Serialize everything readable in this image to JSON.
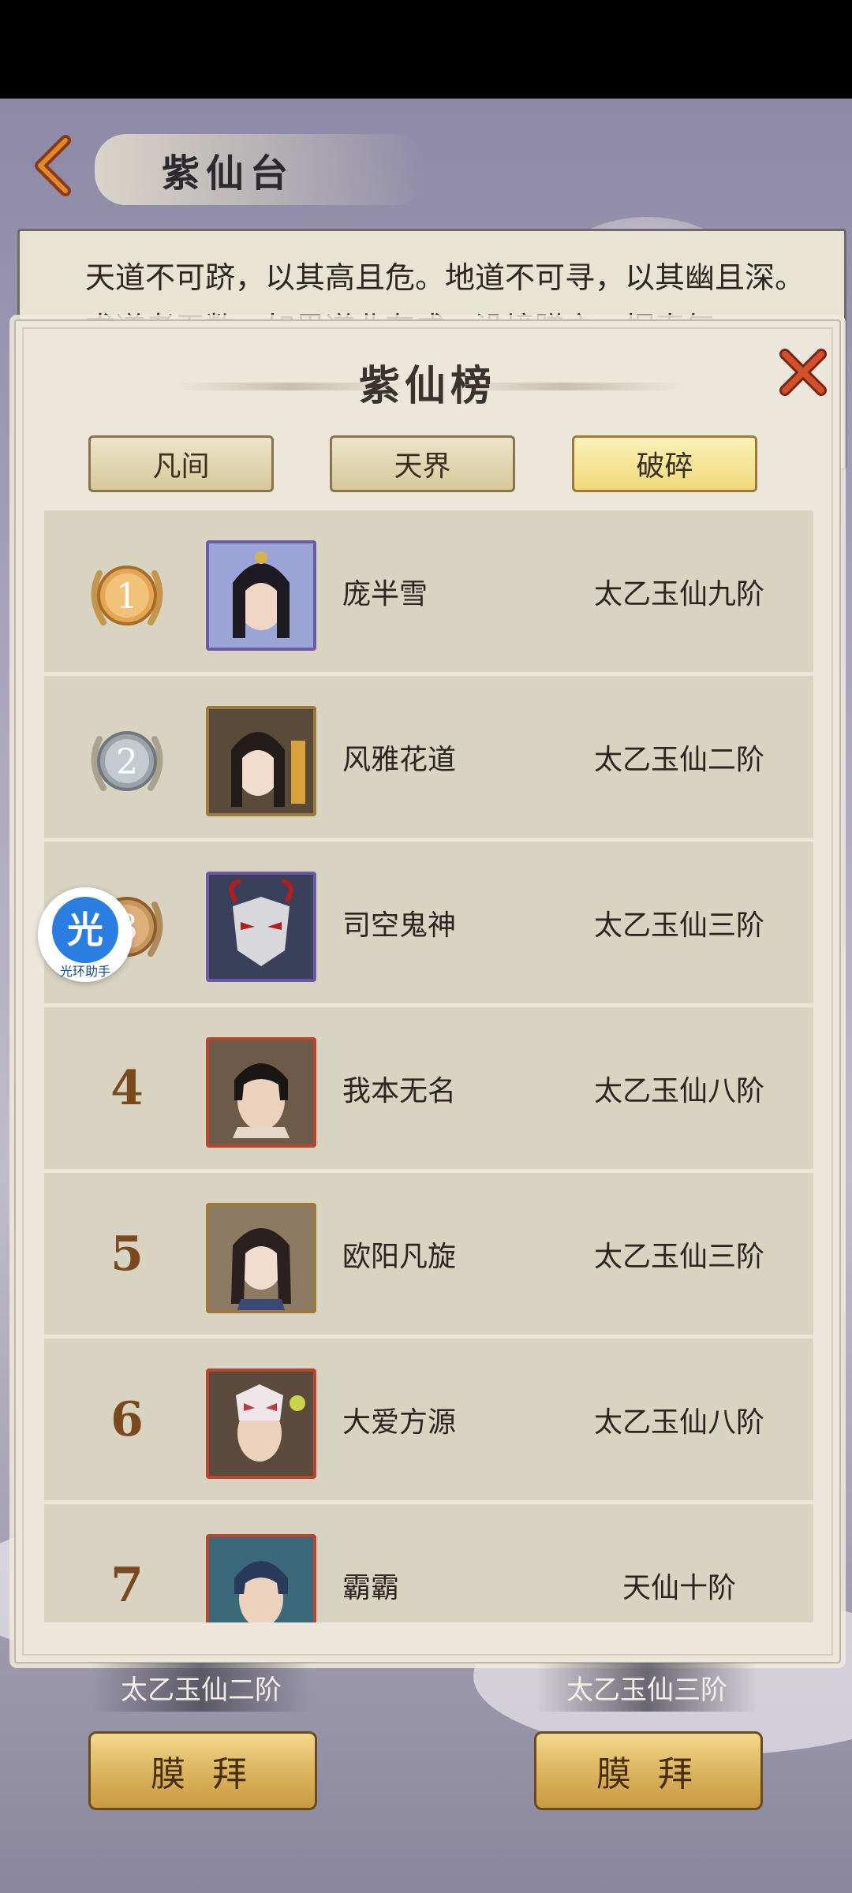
{
  "header": {
    "title": "紫仙台"
  },
  "intro": {
    "text": "天道不可跻，以其高且危。地道不可寻，以其幽且深。求道者无数，如果道业有成，没境蹭之，据真气"
  },
  "modal": {
    "title": "紫仙榜",
    "tabs": [
      "凡间",
      "天界",
      "破碎"
    ],
    "active_tab": "破碎"
  },
  "ranking": [
    {
      "rank": "1",
      "name": "庞半雪",
      "realm": "太乙玉仙九阶"
    },
    {
      "rank": "2",
      "name": "风雅花道",
      "realm": "太乙玉仙二阶"
    },
    {
      "rank": "3",
      "name": "司空鬼神",
      "realm": "太乙玉仙三阶"
    },
    {
      "rank": "4",
      "name": "我本无名",
      "realm": "太乙玉仙八阶"
    },
    {
      "rank": "5",
      "name": "欧阳凡旋",
      "realm": "太乙玉仙三阶"
    },
    {
      "rank": "6",
      "name": "大爱方源",
      "realm": "太乙玉仙八阶"
    },
    {
      "rank": "7",
      "name": "霸霸",
      "realm": "天仙十阶"
    }
  ],
  "assistant": {
    "glyph": "光",
    "label": "光环助手"
  },
  "bottom": {
    "left_realm": "太乙玉仙二阶",
    "right_realm": "太乙玉仙三阶",
    "worship_label": "膜 拜"
  },
  "colors": {
    "accent_gold": "#f0d97a",
    "close_red": "#c0432a",
    "rank_brown": "#7a4a1e"
  }
}
